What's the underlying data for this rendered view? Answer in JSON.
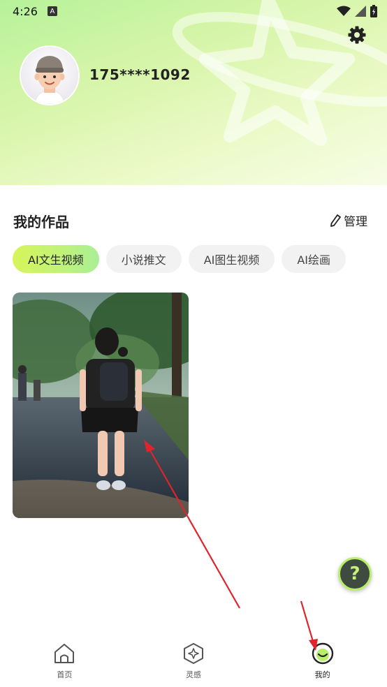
{
  "status_bar": {
    "time": "4:26",
    "notif_icon": "A"
  },
  "profile": {
    "username": "175****1092"
  },
  "works": {
    "title": "我的作品",
    "manage_label": "管理",
    "tabs": [
      {
        "label": "AI文生视频",
        "active": true
      },
      {
        "label": "小说推文",
        "active": false
      },
      {
        "label": "AI图生视频",
        "active": false
      },
      {
        "label": "AI绘画",
        "active": false
      }
    ]
  },
  "help": {
    "label": "?"
  },
  "bottom_nav": {
    "items": [
      {
        "label": "首页",
        "icon": "home-icon"
      },
      {
        "label": "灵感",
        "icon": "inspiration-icon"
      },
      {
        "label": "我的",
        "icon": "profile-icon"
      }
    ]
  },
  "colors": {
    "accent": "#b9ee6a",
    "arrow": "#e0242c"
  }
}
